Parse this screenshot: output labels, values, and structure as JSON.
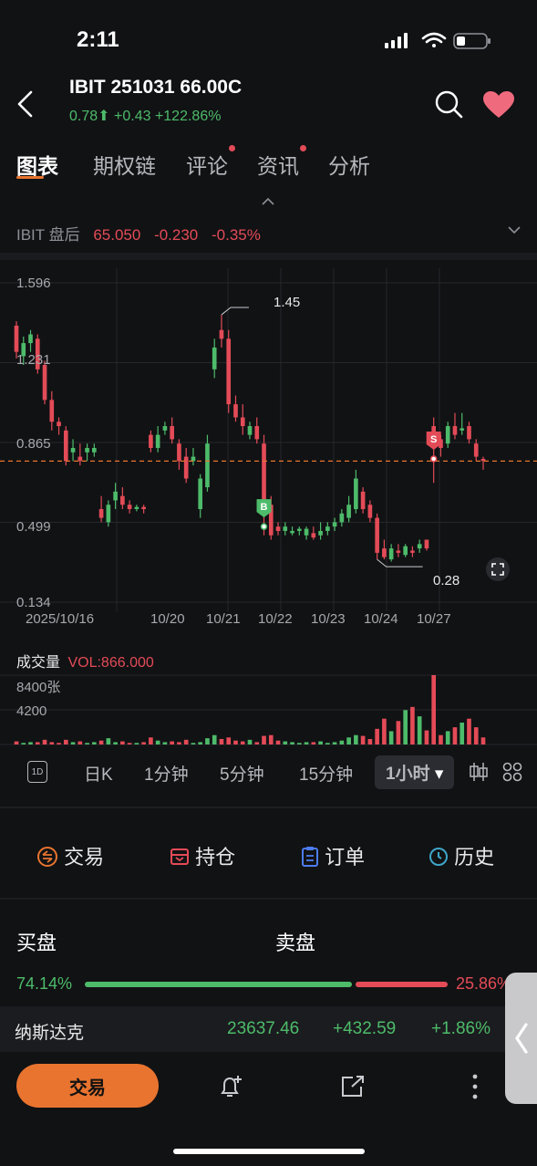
{
  "status": {
    "time": "2:11"
  },
  "header": {
    "title": "IBIT 251031 66.00C",
    "price": "0.78",
    "change": "+0.43",
    "change_pct": "+122.86%"
  },
  "tabs": [
    {
      "label": "图表",
      "active": true
    },
    {
      "label": "期权链",
      "dot": false
    },
    {
      "label": "评论",
      "dot": true
    },
    {
      "label": "资讯",
      "dot": true
    },
    {
      "label": "分析",
      "dot": false
    }
  ],
  "after_hours": {
    "label": "IBIT 盘后",
    "price": "65.050",
    "change": "-0.230",
    "change_pct": "-0.35%"
  },
  "chart": {
    "y_ticks": [
      "1.596",
      "1.231",
      "0.865",
      "0.499",
      "0.134"
    ],
    "x_ticks": [
      "2025/10/16",
      "10/20",
      "10/21",
      "10/22",
      "10/23",
      "10/24",
      "10/27"
    ],
    "high_label": "1.45",
    "low_label": "0.28",
    "marker_b": "B",
    "marker_s": "S",
    "colors": {
      "up": "#4dbb6a",
      "down": "#e34b57",
      "ref": "#e8742f"
    }
  },
  "chart_data": {
    "type": "candlestick",
    "ylim": [
      0.134,
      1.596
    ],
    "current_price": 0.78,
    "candles": [
      [
        1.4,
        1.28,
        1.42,
        1.25
      ],
      [
        1.26,
        1.32,
        1.35,
        1.22
      ],
      [
        1.32,
        1.36,
        1.38,
        1.28
      ],
      [
        1.34,
        1.2,
        1.36,
        1.18
      ],
      [
        1.22,
        1.06,
        1.24,
        1.04
      ],
      [
        1.06,
        0.96,
        1.1,
        0.92
      ],
      [
        0.96,
        0.94,
        0.98,
        0.9
      ],
      [
        0.92,
        0.78,
        0.94,
        0.76
      ],
      [
        0.82,
        0.84,
        0.88,
        0.78
      ],
      [
        0.8,
        0.78,
        0.86,
        0.76
      ],
      [
        0.82,
        0.84,
        0.86,
        0.78
      ],
      [
        0.82,
        0.84,
        0.86,
        0.8
      ],
      [
        0.56,
        0.52,
        0.62,
        0.5
      ],
      [
        0.5,
        0.58,
        0.6,
        0.48
      ],
      [
        0.6,
        0.64,
        0.68,
        0.56
      ],
      [
        0.62,
        0.58,
        0.66,
        0.56
      ],
      [
        0.58,
        0.56,
        0.6,
        0.54
      ],
      [
        0.56,
        0.57,
        0.58,
        0.55
      ],
      [
        0.57,
        0.56,
        0.58,
        0.54
      ],
      [
        0.9,
        0.84,
        0.92,
        0.82
      ],
      [
        0.84,
        0.9,
        0.94,
        0.82
      ],
      [
        0.92,
        0.94,
        0.96,
        0.9
      ],
      [
        0.94,
        0.88,
        0.98,
        0.86
      ],
      [
        0.86,
        0.78,
        0.88,
        0.74
      ],
      [
        0.8,
        0.7,
        0.84,
        0.68
      ],
      [
        0.78,
        0.8,
        0.84,
        0.76
      ],
      [
        0.56,
        0.7,
        0.72,
        0.52
      ],
      [
        0.66,
        0.86,
        0.9,
        0.64
      ],
      [
        1.2,
        1.3,
        1.34,
        1.16
      ],
      [
        1.38,
        1.34,
        1.45,
        1.3
      ],
      [
        1.34,
        1.04,
        1.38,
        1.0
      ],
      [
        1.04,
        0.98,
        1.08,
        0.96
      ],
      [
        0.98,
        0.94,
        1.04,
        0.9
      ],
      [
        0.9,
        0.94,
        0.96,
        0.88
      ],
      [
        0.94,
        0.88,
        0.98,
        0.86
      ],
      [
        0.86,
        0.56,
        0.9,
        0.44
      ],
      [
        0.58,
        0.44,
        0.62,
        0.42
      ],
      [
        0.48,
        0.46,
        0.5,
        0.44
      ],
      [
        0.46,
        0.48,
        0.5,
        0.44
      ],
      [
        0.45,
        0.46,
        0.48,
        0.44
      ],
      [
        0.46,
        0.47,
        0.48,
        0.44
      ],
      [
        0.44,
        0.47,
        0.48,
        0.42
      ],
      [
        0.45,
        0.43,
        0.48,
        0.42
      ],
      [
        0.44,
        0.46,
        0.5,
        0.42
      ],
      [
        0.46,
        0.48,
        0.5,
        0.44
      ],
      [
        0.48,
        0.5,
        0.52,
        0.46
      ],
      [
        0.5,
        0.54,
        0.56,
        0.48
      ],
      [
        0.52,
        0.58,
        0.62,
        0.5
      ],
      [
        0.56,
        0.7,
        0.74,
        0.54
      ],
      [
        0.64,
        0.56,
        0.66,
        0.54
      ],
      [
        0.58,
        0.52,
        0.6,
        0.5
      ],
      [
        0.52,
        0.36,
        0.54,
        0.33
      ],
      [
        0.38,
        0.34,
        0.42,
        0.33
      ],
      [
        0.33,
        0.38,
        0.4,
        0.32
      ],
      [
        0.37,
        0.36,
        0.4,
        0.34
      ],
      [
        0.35,
        0.39,
        0.4,
        0.34
      ],
      [
        0.37,
        0.36,
        0.39,
        0.34
      ],
      [
        0.38,
        0.4,
        0.42,
        0.36
      ],
      [
        0.42,
        0.38,
        0.42,
        0.37
      ],
      [
        0.94,
        0.88,
        0.98,
        0.68
      ],
      [
        0.88,
        0.84,
        0.9,
        0.8
      ],
      [
        0.86,
        0.94,
        0.96,
        0.84
      ],
      [
        0.94,
        0.9,
        1.0,
        0.88
      ],
      [
        0.92,
        0.93,
        1.0,
        0.9
      ],
      [
        0.94,
        0.88,
        0.96,
        0.86
      ],
      [
        0.86,
        0.8,
        0.88,
        0.78
      ],
      [
        0.79,
        0.78,
        0.8,
        0.74
      ]
    ],
    "volume_ylim": [
      0,
      8400
    ],
    "volumes": [
      400,
      200,
      300,
      300,
      600,
      300,
      200,
      600,
      300,
      400,
      200,
      300,
      500,
      800,
      300,
      400,
      200,
      200,
      300,
      900,
      500,
      300,
      400,
      300,
      600,
      200,
      300,
      800,
      1200,
      700,
      900,
      500,
      400,
      600,
      300,
      1100,
      1200,
      500,
      400,
      300,
      200,
      300,
      300,
      400,
      200,
      300,
      500,
      900,
      1200,
      1100,
      700,
      2000,
      3300,
      1700,
      3000,
      4400,
      4800,
      3600,
      1800,
      9500,
      1200,
      1700,
      2200,
      2800,
      3300,
      2200,
      900
    ]
  },
  "volume": {
    "title": "成交量",
    "value": "VOL:866.000",
    "ticks": [
      "8400张",
      "4200"
    ]
  },
  "periods": [
    "1D",
    "日K",
    "1分钟",
    "5分钟",
    "15分钟",
    "1小时"
  ],
  "actions": {
    "trade": "交易",
    "holdings": "持仓",
    "orders": "订单",
    "history": "历史"
  },
  "orderbook": {
    "bid_label": "买盘",
    "ask_label": "卖盘",
    "bid_pct": "74.14%",
    "ask_pct": "25.86%",
    "bid_ratio": 0.7414
  },
  "index": {
    "name": "纳斯达克",
    "value": "23637.46",
    "change": "+432.59",
    "change_pct": "+1.86%"
  },
  "bottom": {
    "trade_button": "交易"
  }
}
